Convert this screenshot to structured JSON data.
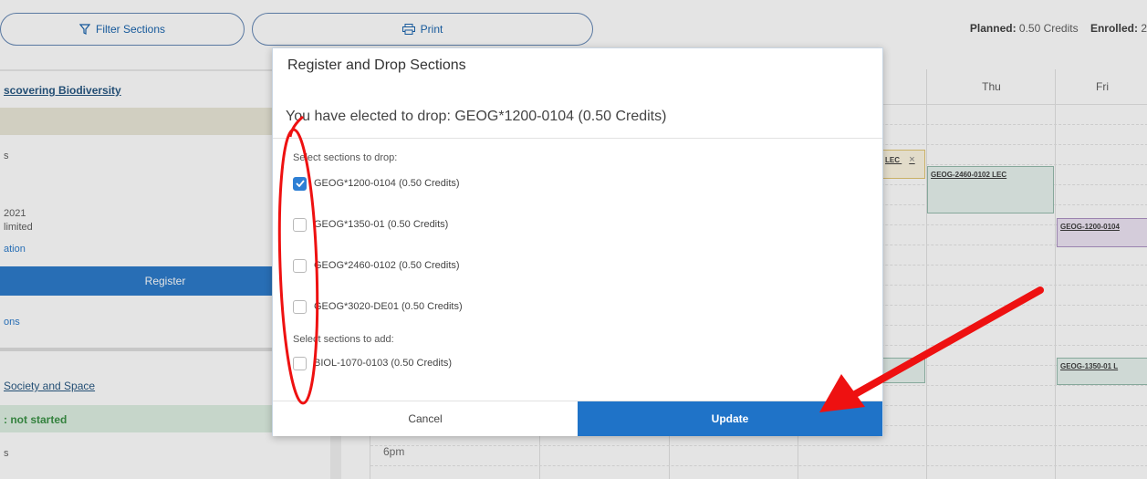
{
  "toolbar": {
    "filter_label": "Filter Sections",
    "print_label": "Print",
    "planned_label": "Planned:",
    "planned_value": "0.50 Credits",
    "enrolled_label": "Enrolled:",
    "enrolled_value": "2"
  },
  "left_panel": {
    "course1_link": "scovering Biodiversity",
    "frag_s1": "s",
    "frag_year": "2021",
    "frag_limited": "limited",
    "frag_ation": "ation",
    "register_label": "Register",
    "frag_ons": "ons",
    "course2_link": "Society and Space",
    "status_text": ": not started",
    "frag_s2": "s"
  },
  "calendar": {
    "days": [
      "Thu",
      "Fri"
    ],
    "time_6pm": "6pm",
    "events": {
      "lec_fragment": "LEC",
      "close_glyph": "×",
      "geog2460": "GEOG-2460-0102 LEC",
      "geog1200": "GEOG-1200-0104",
      "geog1350": "GEOG-1350-01 L"
    }
  },
  "modal": {
    "title": "Register and Drop Sections",
    "message": "You have elected to drop: GEOG*1200-0104 (0.50 Credits)",
    "drop_label": "Select sections to drop:",
    "drop_options": [
      {
        "label": "GEOG*1200-0104 (0.50 Credits)",
        "checked": true
      },
      {
        "label": "GEOG*1350-01 (0.50 Credits)",
        "checked": false
      },
      {
        "label": "GEOG*2460-0102 (0.50 Credits)",
        "checked": false
      },
      {
        "label": "GEOG*3020-DE01 (0.50 Credits)",
        "checked": false
      }
    ],
    "add_label": "Select sections to add:",
    "add_options": [
      {
        "label": "BIOL-1070-0103 (0.50 Credits)",
        "checked": false
      }
    ],
    "cancel_label": "Cancel",
    "update_label": "Update"
  },
  "colors": {
    "primary": "#1f73c8",
    "annotation": "#e11",
    "thu_event_bg": "#e6f2ee",
    "fri_event_bg": "#ece3f3"
  }
}
